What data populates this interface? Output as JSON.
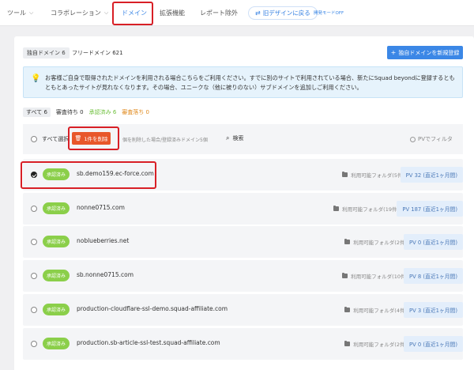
{
  "nav": {
    "items": [
      {
        "label": "ツール",
        "chevron": true
      },
      {
        "label": "コラボレーション",
        "chevron": true
      },
      {
        "label": "ドメイン",
        "chevron": false,
        "active": true
      },
      {
        "label": "拡張機能",
        "chevron": false
      },
      {
        "label": "レポート除外",
        "chevron": false
      }
    ],
    "old_design_label": "旧デザインに戻る",
    "dev_mode_label": "開発モードOFF"
  },
  "tabs": {
    "own_domain": "独自ドメイン 6",
    "free_domain": "フリードメイン 621"
  },
  "register_button": "独自ドメインを新規登録",
  "info_text": "お客様ご自身で取得されたドメインを利用される場合こちらをご利用ください。すでに別のサイトで利用されている場合、新たにSquad beyondに登録するともともとあったサイトが見れなくなります。その場合、ユニークな（他に被りのない）サブドメインを追加しご利用ください。",
  "filters": {
    "all": "すべて 6",
    "pending": "審査待ち 0",
    "approved": "承認済み 6",
    "rejected": "審査落ち 0"
  },
  "toolbar": {
    "select_all": "すべて選択",
    "delete_button": "1件を削除",
    "delete_note": "個を削除した場合/登録済みドメイン5個",
    "search": "検索",
    "pv_filter": "PVでフィルタ"
  },
  "colors": {
    "accent": "#3b87e6",
    "approved": "#8bcf4a",
    "delete": "#e8572a",
    "highlight": "#d81f26"
  },
  "domains": [
    {
      "checked": true,
      "status": "承認済み",
      "name": "sb.demo159.ec-force.com",
      "folders": "利用可能フォルダ(5件)",
      "pv": "PV 32 (直近1ヶ月間)"
    },
    {
      "checked": false,
      "status": "承認済み",
      "name": "nonne0715.com",
      "folders": "利用可能フォルダ(19件)",
      "pv": "PV 187 (直近1ヶ月間)"
    },
    {
      "checked": false,
      "status": "承認済み",
      "name": "noblueberries.net",
      "folders": "利用可能フォルダ(2件)",
      "pv": "PV 0 (直近1ヶ月間)"
    },
    {
      "checked": false,
      "status": "承認済み",
      "name": "sb.nonne0715.com",
      "folders": "利用可能フォルダ(10件)",
      "pv": "PV 8 (直近1ヶ月間)"
    },
    {
      "checked": false,
      "status": "承認済み",
      "name": "production-cloudflare-ssl-demo.squad-affiliate.com",
      "folders": "利用可能フォルダ(4件)",
      "pv": "PV 3 (直近1ヶ月間)"
    },
    {
      "checked": false,
      "status": "承認済み",
      "name": "production.sb-article-ssl-test.squad-affiliate.com",
      "folders": "利用可能フォルダ(2件)",
      "pv": "PV 0 (直近1ヶ月間)"
    }
  ]
}
